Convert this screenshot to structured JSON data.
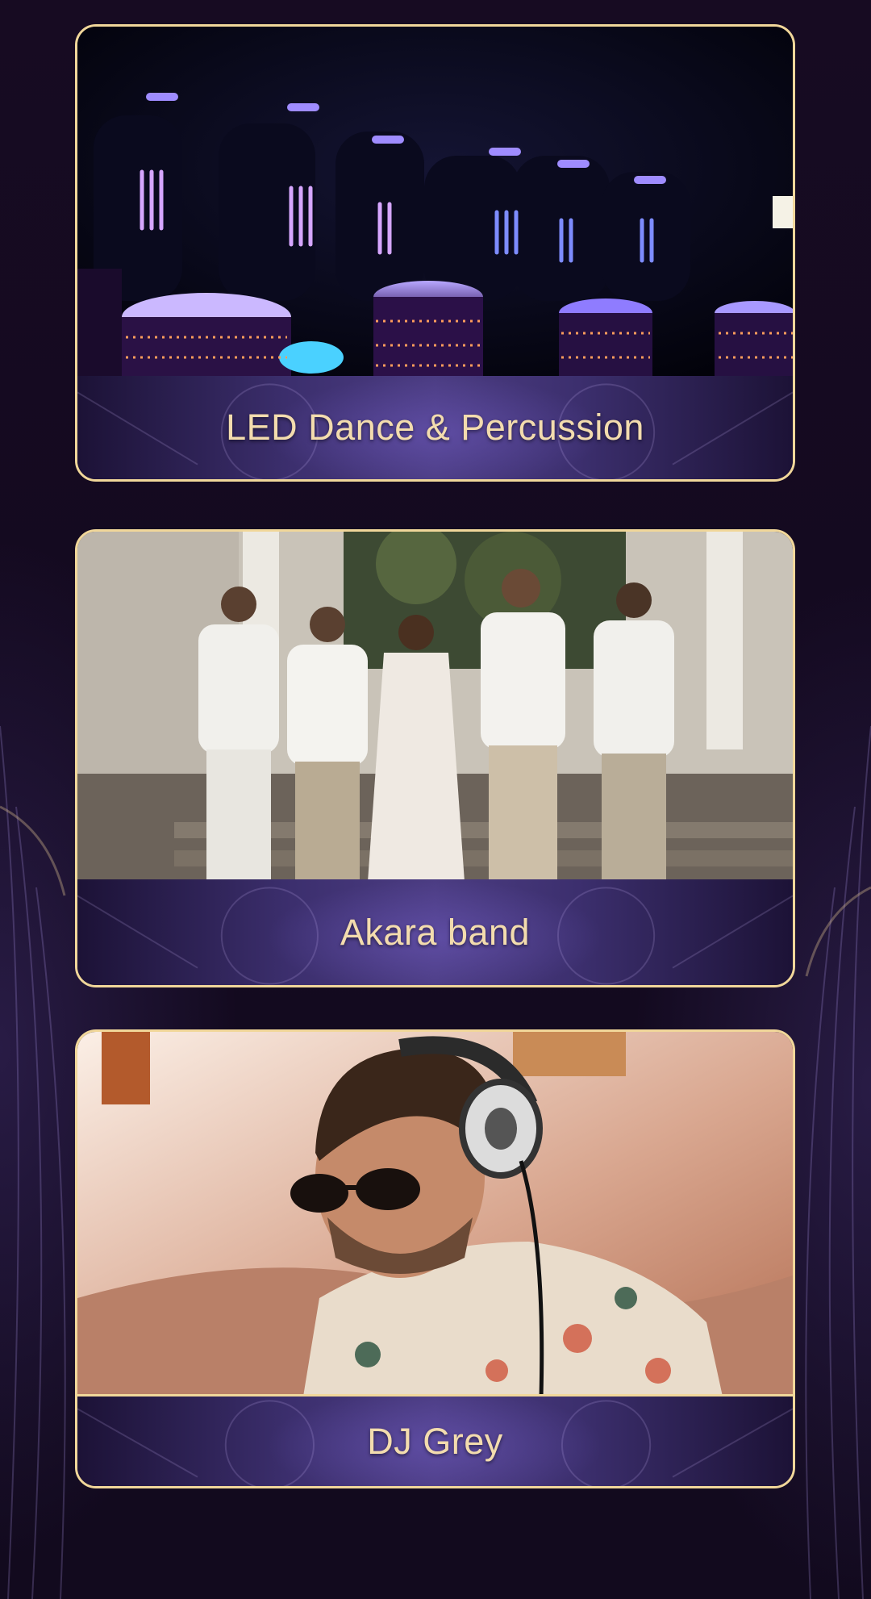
{
  "cards": [
    {
      "caption": "LED Dance & Percussion",
      "photo_icon": "led-drummers-photo"
    },
    {
      "caption": "Akara band",
      "photo_icon": "band-group-photo"
    },
    {
      "caption": "DJ Grey",
      "photo_icon": "dj-headphones-photo"
    }
  ],
  "colors": {
    "background": "#150a21",
    "border_gold": "#f1d79a",
    "caption_text": "#f3dcae",
    "caption_band": "#3c2f6e"
  }
}
